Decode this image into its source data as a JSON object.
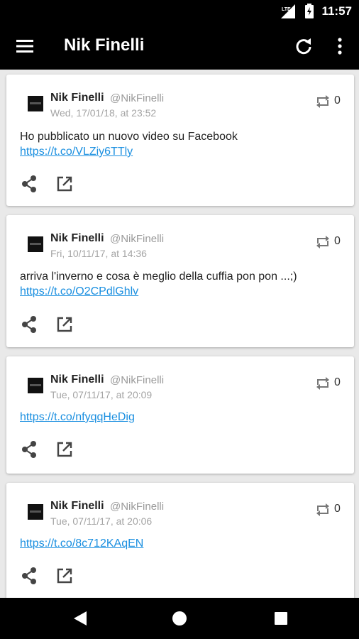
{
  "status": {
    "time": "11:57",
    "network": "LTE"
  },
  "appbar": {
    "title": "Nik Finelli"
  },
  "tweets": [
    {
      "name": "Nik Finelli",
      "handle": "@NikFinelli",
      "date": "Wed, 17/01/18, at 23:52",
      "text": "Ho pubblicato un nuovo video su Facebook",
      "link": "https://t.co/VLZiy6TTly",
      "retweets": "0"
    },
    {
      "name": "Nik Finelli",
      "handle": "@NikFinelli",
      "date": "Fri, 10/11/17, at 14:36",
      "text": "arriva l'inverno e cosa è meglio della cuffia pon pon ...;)",
      "link": "https://t.co/O2CPdlGhlv",
      "retweets": "0"
    },
    {
      "name": "Nik Finelli",
      "handle": "@NikFinelli",
      "date": "Tue, 07/11/17, at 20:09",
      "text": "",
      "link": "https://t.co/nfyqqHeDig",
      "retweets": "0"
    },
    {
      "name": "Nik Finelli",
      "handle": "@NikFinelli",
      "date": "Tue, 07/11/17, at 20:06",
      "text": "",
      "link": "https://t.co/8c712KAqEN",
      "retweets": "0"
    }
  ],
  "icons": {
    "menu": "hamburger-icon",
    "refresh": "refresh-icon",
    "more": "more-vert-icon",
    "retweet": "retweet-icon",
    "share": "share-icon",
    "open": "open-external-icon",
    "back": "back-triangle-icon",
    "home": "home-circle-icon",
    "recent": "recent-square-icon"
  },
  "colors": {
    "bar": "#000000",
    "link": "#1a8fe0",
    "card": "#ffffff",
    "background": "#e9e9e9"
  }
}
